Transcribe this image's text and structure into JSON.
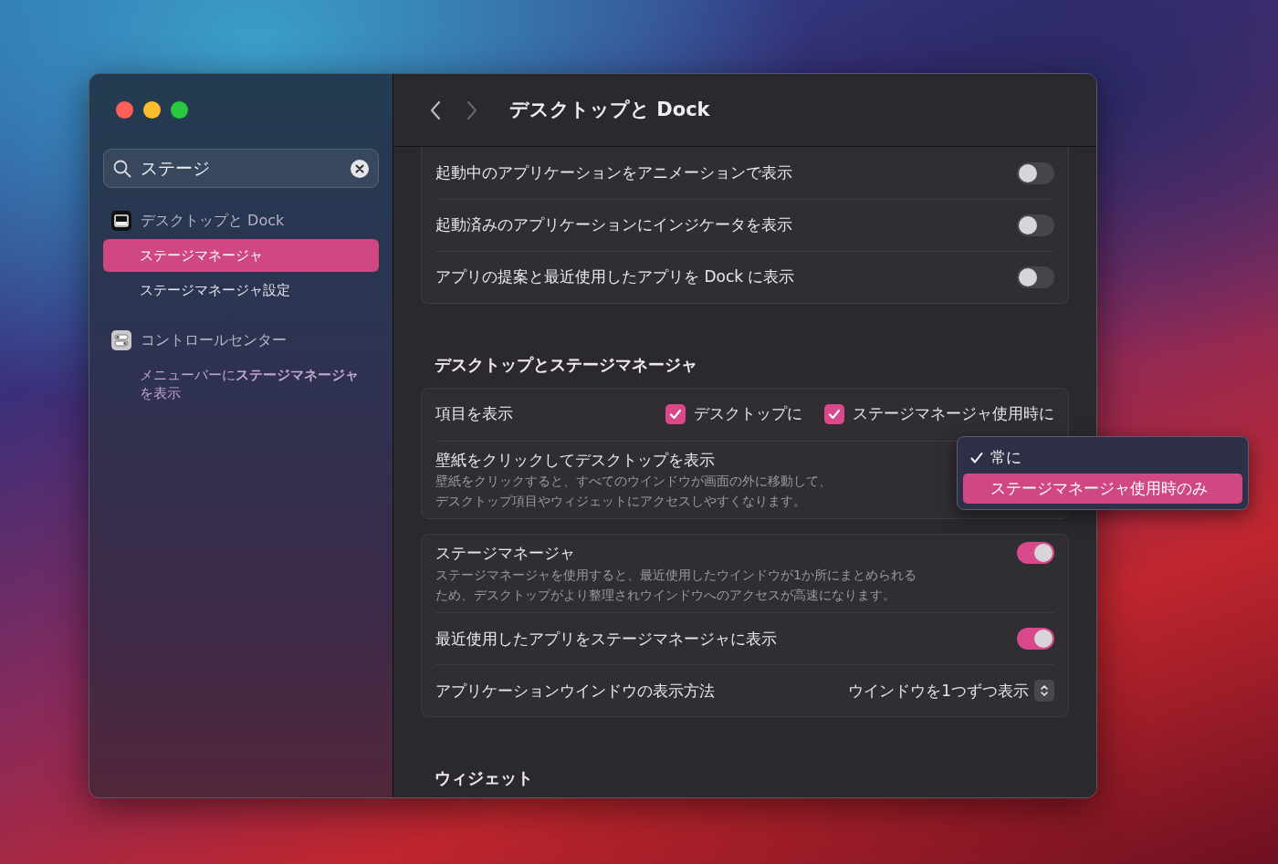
{
  "window": {
    "title": "デスクトップと Dock"
  },
  "sidebar": {
    "search": {
      "value": "ステージ"
    },
    "groups": [
      {
        "label": "デスクトップと Dock",
        "items": [
          {
            "label": "ステージマネージャ",
            "selected": true
          },
          {
            "label": "ステージマネージャ設定",
            "selected": false
          }
        ]
      },
      {
        "label": "コントロールセンター",
        "items": [
          {
            "label": "メニューバーに**ステージマネージャ**を表示",
            "selected": false
          }
        ]
      }
    ]
  },
  "sections": [
    {
      "rows": [
        {
          "kind": "toggle",
          "label": "起動中のアプリケーションをアニメーションで表示",
          "on": false
        },
        {
          "kind": "toggle",
          "label": "起動済みのアプリケーションにインジケータを表示",
          "on": false
        },
        {
          "kind": "toggle",
          "label": "アプリの提案と最近使用したアプリを Dock に表示",
          "on": false
        }
      ]
    },
    {
      "heading": "デスクトップとステージマネージャ",
      "rows": [
        {
          "kind": "checks",
          "label": "項目を表示",
          "checks": [
            {
              "label": "デスクトップに",
              "checked": true
            },
            {
              "label": "ステージマネージャ使用時に",
              "checked": true
            }
          ]
        },
        {
          "kind": "menu",
          "label": "壁紙をクリックしてデスクトップを表示",
          "description": "壁紙をクリックすると、すべてのウインドウが画面の外に移動して、デスクトップ項目やウィジェットにアクセスしやすくなります。",
          "menu": [
            {
              "label": "常に",
              "checked": true,
              "selected": false
            },
            {
              "label": "ステージマネージャ使用時のみ",
              "checked": false,
              "selected": true
            }
          ]
        }
      ]
    },
    {
      "rows": [
        {
          "kind": "toggle",
          "label": "ステージマネージャ",
          "description": "ステージマネージャを使用すると、最近使用したウインドウが1か所にまとめられるため、デスクトップがより整理されウインドウへのアクセスが高速になります。",
          "on": true
        },
        {
          "kind": "toggle",
          "label": "最近使用したアプリをステージマネージャに表示",
          "on": true
        },
        {
          "kind": "select",
          "label": "アプリケーションウインドウの表示方法",
          "value": "ウインドウを1つずつ表示"
        }
      ]
    },
    {
      "heading": "ウィジェット"
    }
  ]
}
